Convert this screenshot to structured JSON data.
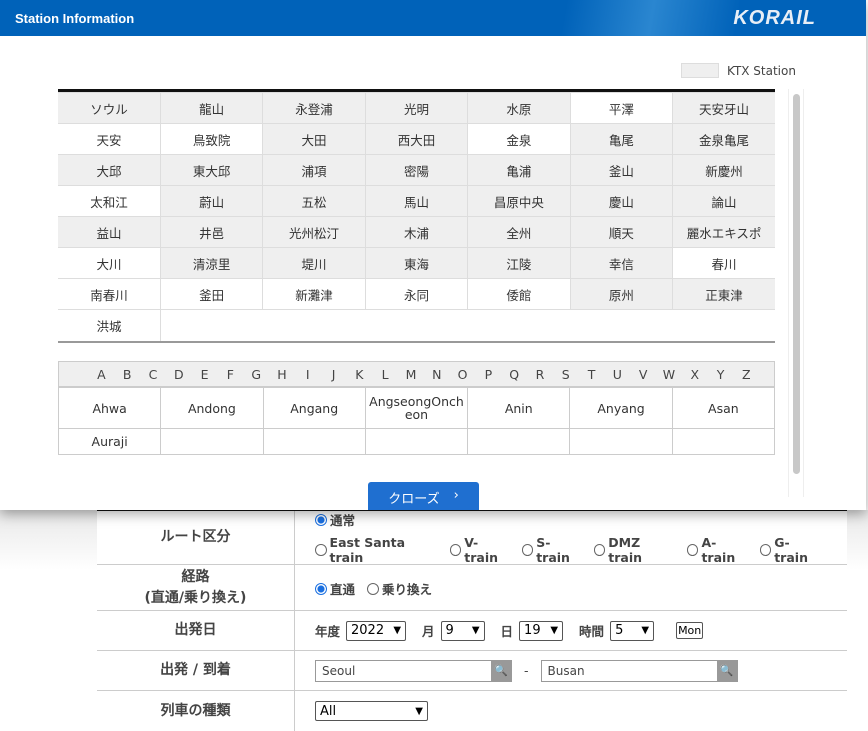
{
  "modal": {
    "title": "Station Information",
    "logo": "KORAIL",
    "legend": "KTX Station",
    "close_label": "クローズ",
    "stations": [
      [
        [
          "ソウル",
          1
        ],
        [
          "龍山",
          1
        ],
        [
          "永登浦",
          1
        ],
        [
          "光明",
          1
        ],
        [
          "水原",
          1
        ],
        [
          "平澤",
          0
        ],
        [
          "天安牙山",
          1
        ]
      ],
      [
        [
          "天安",
          0
        ],
        [
          "鳥致院",
          0
        ],
        [
          "大田",
          1
        ],
        [
          "西大田",
          1
        ],
        [
          "金泉",
          0
        ],
        [
          "亀尾",
          1
        ],
        [
          "金泉亀尾",
          1
        ]
      ],
      [
        [
          "大邱",
          1
        ],
        [
          "東大邱",
          1
        ],
        [
          "浦項",
          1
        ],
        [
          "密陽",
          1
        ],
        [
          "亀浦",
          1
        ],
        [
          "釜山",
          1
        ],
        [
          "新慶州",
          1
        ]
      ],
      [
        [
          "太和江",
          0
        ],
        [
          "蔚山",
          1
        ],
        [
          "五松",
          1
        ],
        [
          "馬山",
          1
        ],
        [
          "昌原中央",
          1
        ],
        [
          "慶山",
          1
        ],
        [
          "論山",
          1
        ]
      ],
      [
        [
          "益山",
          1
        ],
        [
          "井邑",
          1
        ],
        [
          "光州松汀",
          1
        ],
        [
          "木浦",
          1
        ],
        [
          "全州",
          1
        ],
        [
          "順天",
          1
        ],
        [
          "麗水エキスポ",
          1
        ]
      ],
      [
        [
          "大川",
          0
        ],
        [
          "清涼里",
          1
        ],
        [
          "堤川",
          1
        ],
        [
          "東海",
          1
        ],
        [
          "江陵",
          1
        ],
        [
          "幸信",
          1
        ],
        [
          "春川",
          0
        ]
      ],
      [
        [
          "南春川",
          0
        ],
        [
          "釜田",
          0
        ],
        [
          "新灘津",
          0
        ],
        [
          "永同",
          0
        ],
        [
          "倭館",
          0
        ],
        [
          "原州",
          1
        ],
        [
          "正東津",
          1
        ]
      ],
      [
        [
          "洪城",
          0
        ]
      ]
    ],
    "letters": [
      "A",
      "B",
      "C",
      "D",
      "E",
      "F",
      "G",
      "H",
      "I",
      "J",
      "K",
      "L",
      "M",
      "N",
      "O",
      "P",
      "Q",
      "R",
      "S",
      "T",
      "U",
      "V",
      "W",
      "X",
      "Y",
      "Z"
    ],
    "alpha_stations": [
      [
        "Ahwa",
        "Andong",
        "Angang",
        "AngseongOncheon",
        "Anin",
        "Anyang",
        "Asan"
      ],
      [
        "Auraji",
        "",
        "",
        "",
        "",
        "",
        ""
      ]
    ]
  },
  "form": {
    "route_label": "ルート区分",
    "route_normal": "通常",
    "route_options": [
      "East Santa train",
      "V-train",
      "S-train",
      "DMZ train",
      "A-train",
      "G-train"
    ],
    "path_label": "経路",
    "path_label2": "(直通/乗り換え)",
    "path_direct": "直通",
    "path_transfer": "乗り換え",
    "date_label": "出発日",
    "year_label": "年度",
    "year": "2022",
    "month_label": "月",
    "month": "9",
    "day_label": "日",
    "day": "19",
    "hour_label": "時間",
    "hour": "5",
    "weekday": "Mon",
    "dep_arr_label": "出発 / 到着",
    "departure": "Seoul",
    "arrival": "Busan",
    "dash": "-",
    "train_type_label": "列車の種類",
    "train_type": "All"
  },
  "colors": {
    "header": "#0062b9",
    "ktx_cell": "#efefef",
    "button": "#1f6fd0"
  }
}
